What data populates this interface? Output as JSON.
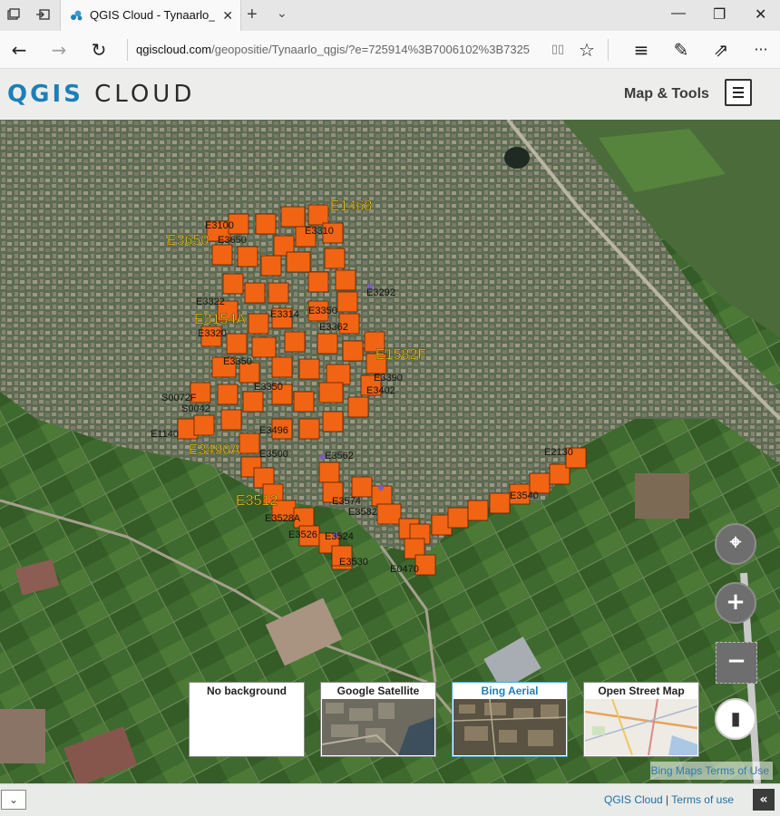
{
  "browser": {
    "tab_title": "QGIS Cloud - Tynaarlo_qgis",
    "close_glyph": "✕",
    "new_tab_glyph": "+",
    "tab_menu_glyph": "⌄",
    "url_host": "qgiscloud.com",
    "url_path": "/geopositie/Tynaarlo_qgis/?e=725914%3B7006102%3B7325",
    "back_glyph": "←",
    "forward_glyph": "→",
    "refresh_glyph": "↻",
    "reading_glyph": "▯▯",
    "favorite_glyph": "☆",
    "hub_glyph": "≡",
    "notes_glyph": "✎",
    "share_glyph": "⇗",
    "more_glyph": "···",
    "minimize_glyph": "—",
    "restore_glyph": "❐",
    "window_close_glyph": "✕",
    "icons": [
      "tabs-icon",
      "tab-aside-icon",
      "qgis-favicon"
    ]
  },
  "app": {
    "logo_q": "QGIS",
    "logo_rest": " CLOUD",
    "map_tools_label": "Map & Tools",
    "accent": "#1d7fb8"
  },
  "map": {
    "feature_color": "#f06414",
    "yellow_labels": [
      {
        "text": "E1468"
      },
      {
        "text": "E3650"
      },
      {
        "text": "E3154A"
      },
      {
        "text": "E1582F"
      },
      {
        "text": "E3490A"
      },
      {
        "text": "E3512"
      }
    ],
    "black_labels": [
      {
        "text": "E3350"
      },
      {
        "text": "E3496"
      },
      {
        "text": "E3500"
      },
      {
        "text": "E3562"
      },
      {
        "text": "E3574"
      },
      {
        "text": "E3582"
      },
      {
        "text": "E3524"
      },
      {
        "text": "E3530"
      },
      {
        "text": "E0470"
      },
      {
        "text": "E3528A"
      },
      {
        "text": "E3526"
      },
      {
        "text": "E3314"
      },
      {
        "text": "E3100"
      },
      {
        "text": "E3322"
      },
      {
        "text": "E3350"
      },
      {
        "text": "E3320"
      },
      {
        "text": "E3650"
      },
      {
        "text": "E2130"
      },
      {
        "text": "E3350"
      },
      {
        "text": "E3362"
      },
      {
        "text": "E3402"
      },
      {
        "text": "E3390"
      },
      {
        "text": "E3292"
      },
      {
        "text": "S0072F"
      },
      {
        "text": "S0042"
      },
      {
        "text": "E1140"
      },
      {
        "text": "E3540"
      },
      {
        "text": "E3310"
      }
    ]
  },
  "controls": {
    "locate_glyph": "⌖",
    "zoom_in_glyph": "+",
    "zoom_out_glyph": "−",
    "layers_glyph": "▮"
  },
  "backgrounds": [
    {
      "label": "No background",
      "active": false
    },
    {
      "label": "Google Satellite",
      "active": false
    },
    {
      "label": "Bing Aerial",
      "active": true
    },
    {
      "label": "Open Street Map",
      "active": false
    }
  ],
  "bing_terms": "Bing Maps Terms of Use",
  "footer": {
    "select_glyph": "⌄",
    "qgis_cloud_link": "QGIS Cloud",
    "separator": "|",
    "terms_link": "Terms of use",
    "collapse_glyph": "«"
  }
}
